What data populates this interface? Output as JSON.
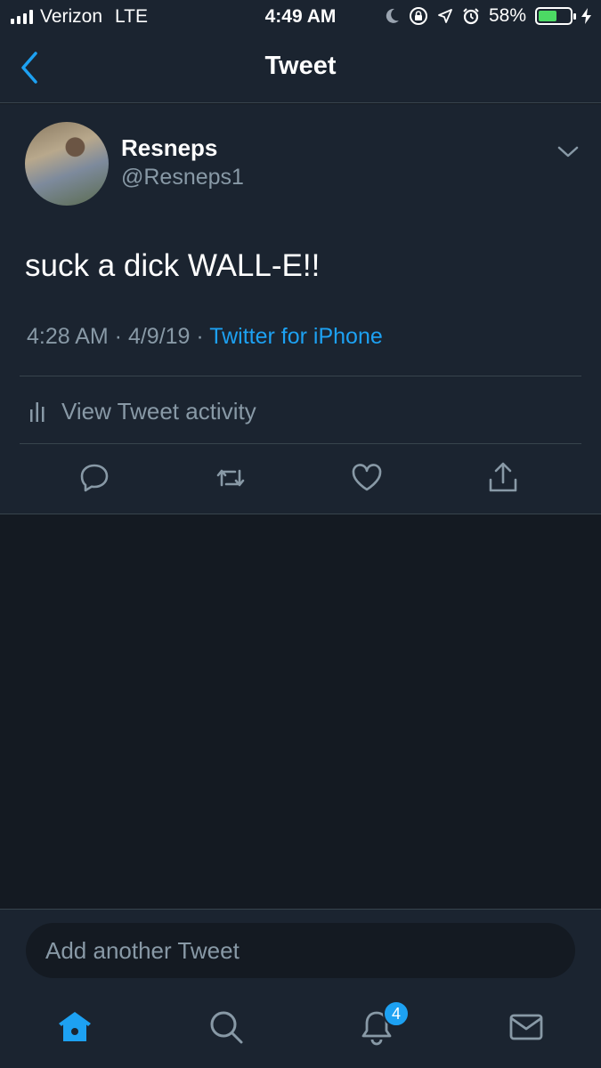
{
  "status_bar": {
    "carrier": "Verizon",
    "network": "LTE",
    "time": "4:49 AM",
    "battery": "58%",
    "battery_level": 0.58
  },
  "header": {
    "title": "Tweet",
    "back_icon": "chevron-left-icon"
  },
  "tweet": {
    "display_name": "Resneps",
    "handle": "@Resneps1",
    "text": "suck a dick WALL-E!!",
    "timestamp": "4:28 AM · 4/9/19 · ",
    "source": "Twitter for iPhone",
    "activity_label": "View Tweet activity"
  },
  "actions": [
    "reply-icon",
    "retweet-icon",
    "like-icon",
    "share-icon"
  ],
  "compose": {
    "placeholder": "Add another Tweet"
  },
  "tab_bar": {
    "tabs": [
      "home-icon",
      "search-icon",
      "notifications-icon",
      "messages-icon"
    ],
    "notification_count": "4"
  },
  "colors": {
    "background": "#141a22",
    "surface": "#1b2430",
    "accent": "#1da1f2",
    "secondary_text": "#8899a6",
    "battery": "#4cd964"
  }
}
